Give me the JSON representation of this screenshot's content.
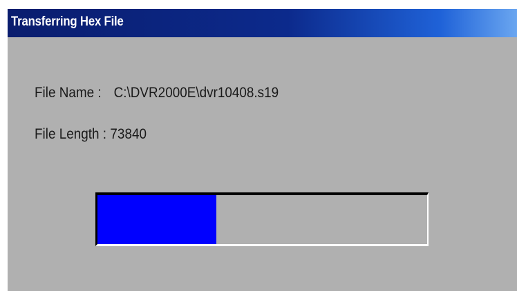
{
  "window": {
    "title": "Transferring Hex File"
  },
  "fields": {
    "file_name_label": "File Name :",
    "file_name_value": "C:\\DVR2000E\\dvr10408.s19",
    "file_length_label": "File Length :",
    "file_length_value": "73840"
  },
  "progress": {
    "fraction": 0.36,
    "fill_color": "#0000ff"
  },
  "colors": {
    "dialog_background": "#b0b0b0",
    "titlebar_dark": "#0a1d6e",
    "titlebar_light": "#6aa6f0"
  }
}
